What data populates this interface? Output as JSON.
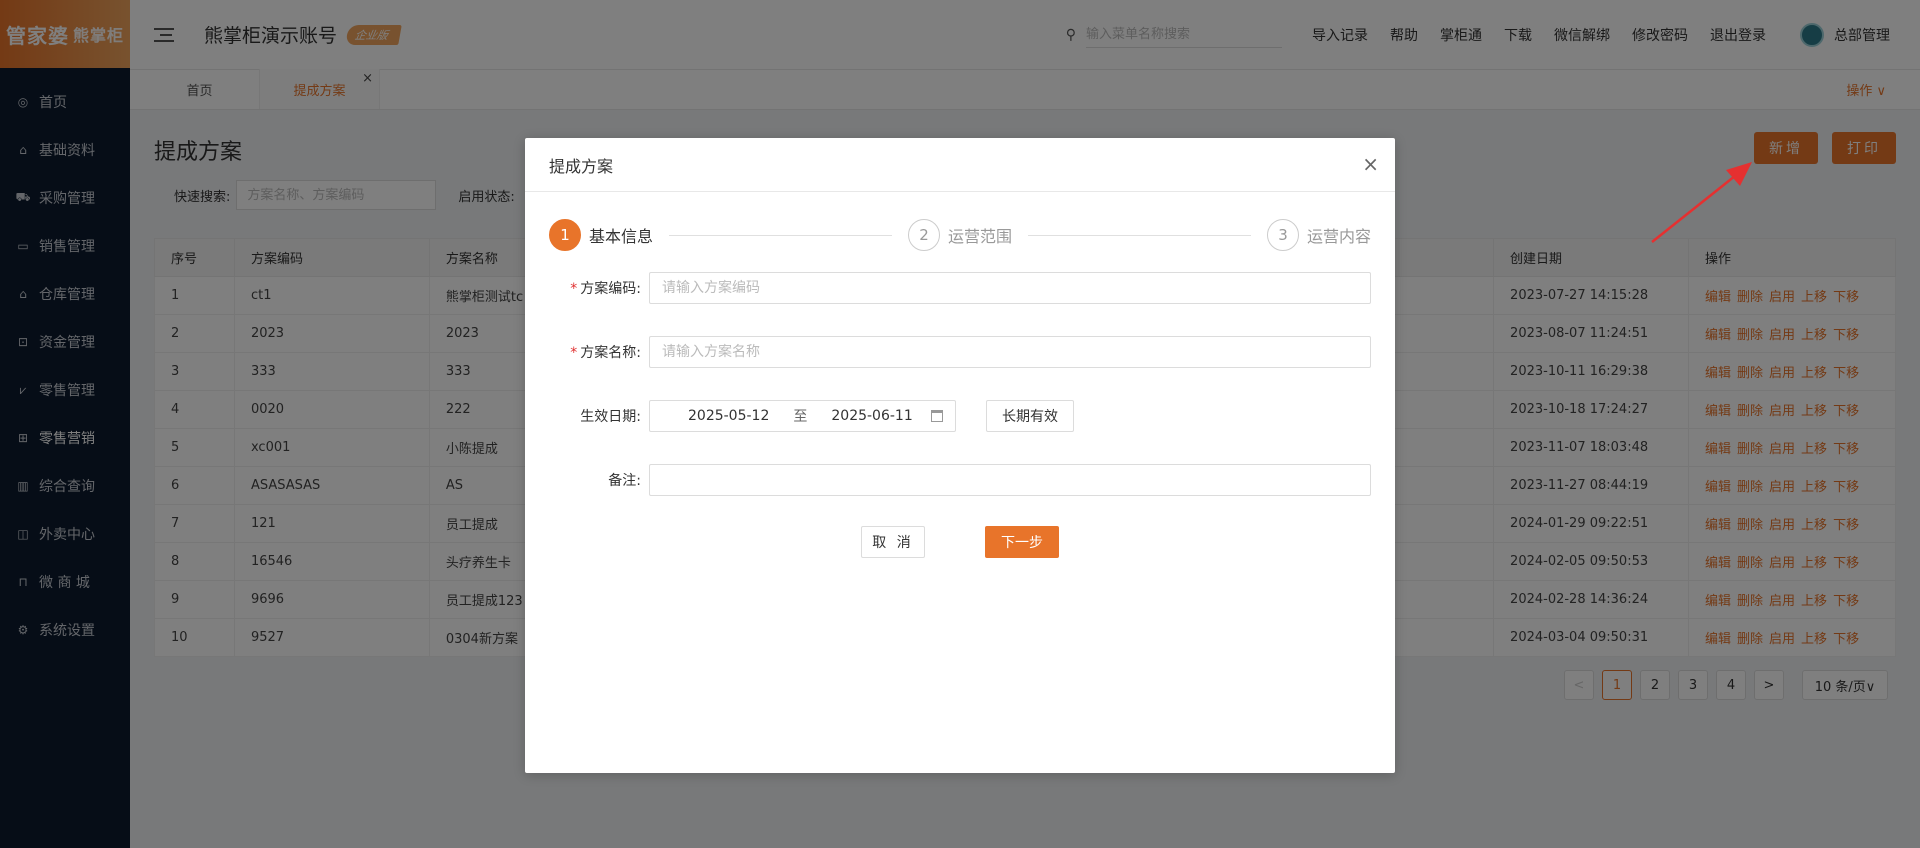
{
  "brand": {
    "logo_a": "管家婆",
    "logo_b": "熊掌柜",
    "accent": "#e8742a"
  },
  "sidebar": {
    "items": [
      {
        "label": "首页",
        "icon": "globe-icon"
      },
      {
        "label": "基础资料",
        "icon": "home-icon"
      },
      {
        "label": "采购管理",
        "icon": "cart-icon"
      },
      {
        "label": "销售管理",
        "icon": "monitor-icon"
      },
      {
        "label": "仓库管理",
        "icon": "warehouse-icon"
      },
      {
        "label": "资金管理",
        "icon": "money-icon"
      },
      {
        "label": "零售管理",
        "icon": "chart-icon"
      },
      {
        "label": "零售营销",
        "icon": "gift-icon"
      },
      {
        "label": "综合查询",
        "icon": "bar-chart-icon"
      },
      {
        "label": "外卖中心",
        "icon": "delivery-icon"
      },
      {
        "label": "微 商 城",
        "icon": "bag-icon"
      },
      {
        "label": "系统设置",
        "icon": "gear-icon"
      }
    ]
  },
  "header": {
    "account_name": "熊掌柜演示账号",
    "edition": "企业版",
    "search_placeholder": "输入菜单名称搜索",
    "links": [
      "导入记录",
      "帮助",
      "掌柜通",
      "下载",
      "微信解绑",
      "修改密码",
      "退出登录"
    ],
    "user": "总部管理"
  },
  "tabs": {
    "home": "首页",
    "current": "提成方案",
    "close": "×",
    "ops": "操作 ∨"
  },
  "page": {
    "title": "提成方案",
    "new_btn": "新增",
    "print_btn": "打印",
    "quick_search_label": "快速搜索:",
    "quick_search_placeholder": "方案名称、方案编码",
    "status_label": "启用状态:"
  },
  "table": {
    "columns": [
      "序号",
      "方案编码",
      "方案名称",
      "创建日期",
      "操作"
    ],
    "actions": [
      "编辑",
      "删除",
      "启用",
      "上移",
      "下移"
    ],
    "rows": [
      [
        "1",
        "ct1",
        "熊掌柜测试tc",
        "2023-07-27 14:15:28"
      ],
      [
        "2",
        "2023",
        "2023",
        "2023-08-07 11:24:51"
      ],
      [
        "3",
        "333",
        "333",
        "2023-10-11 16:29:38"
      ],
      [
        "4",
        "0020",
        "222",
        "2023-10-18 17:24:27"
      ],
      [
        "5",
        "xc001",
        "小陈提成",
        "2023-11-07 18:03:48"
      ],
      [
        "6",
        "ASASASAS",
        "AS",
        "2023-11-27 08:44:19"
      ],
      [
        "7",
        "121",
        "员工提成",
        "2024-01-29 09:22:51"
      ],
      [
        "8",
        "16546",
        "头疗养生卡",
        "2024-02-05 09:50:53"
      ],
      [
        "9",
        "9696",
        "员工提成123",
        "2024-02-28 14:36:24"
      ],
      [
        "10",
        "9527",
        "0304新方案",
        "2024-03-04 09:50:31"
      ]
    ]
  },
  "pagination": {
    "prev": "<",
    "pages": [
      "1",
      "2",
      "3",
      "4"
    ],
    "current": "1",
    "next": ">",
    "page_size": "10 条/页∨"
  },
  "modal": {
    "title": "提成方案",
    "close": "×",
    "steps": [
      {
        "num": "1",
        "label": "基本信息",
        "active": true
      },
      {
        "num": "2",
        "label": "运营范围",
        "active": false
      },
      {
        "num": "3",
        "label": "运营内容",
        "active": false
      }
    ],
    "fields": {
      "code_label": "方案编码:",
      "code_placeholder": "请输入方案编码",
      "name_label": "方案名称:",
      "name_placeholder": "请输入方案名称",
      "date_label": "生效日期:",
      "date_start": "2025-05-12",
      "date_sep": "至",
      "date_end": "2025-06-11",
      "long_term_btn": "长期有效",
      "remark_label": "备注:",
      "required_mark": "*"
    },
    "cancel_btn": "取 消",
    "next_btn": "下一步"
  }
}
